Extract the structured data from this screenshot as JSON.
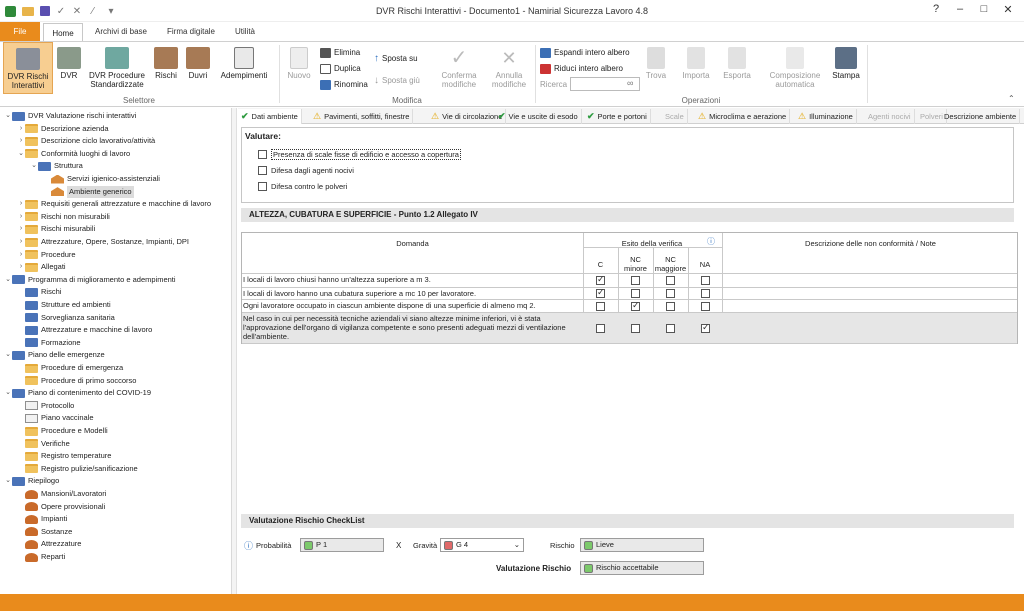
{
  "app": {
    "title": "DVR Rischi Interattivi - Documento1 - Namirial Sicurezza Lavoro 4.8",
    "help": "?",
    "minimize": "–",
    "maximize": "□",
    "close": "✕"
  },
  "tabs": {
    "file": "File",
    "home": "Home",
    "archivi": "Archivi di base",
    "firma": "Firma digitale",
    "utilita": "Utilità"
  },
  "ribbon": {
    "dvr_rischi": "DVR Rischi Interattivi",
    "dvr": "DVR",
    "dvr_proc": "DVR Procedure Standardizzate",
    "rischi": "Rischi",
    "duvri": "Duvri",
    "adempimenti": "Adempimenti",
    "group_selettore": "Selettore",
    "nuovo": "Nuovo",
    "elimina": "Elimina",
    "duplica": "Duplica",
    "rinomina": "Rinomina",
    "sposta_su": "Sposta su",
    "sposta_giu": "Sposta giù",
    "conferma": "Conferma modifiche",
    "annulla": "Annulla modifiche",
    "group_modifica": "Modifica",
    "espandi": "Espandi intero albero",
    "riduci": "Riduci intero albero",
    "ricerca": "Ricerca",
    "trova": "Trova",
    "importa": "Importa",
    "esporta": "Esporta",
    "composizione": "Composizione automatica",
    "stampa": "Stampa",
    "group_operazioni": "Operazioni"
  },
  "tree": [
    {
      "label": "DVR Valutazione rischi interattivi",
      "lvl": 0,
      "icon": "docblue",
      "tog": "⌄"
    },
    {
      "label": "Descrizione azienda",
      "lvl": 1,
      "icon": "folder",
      "tog": "›"
    },
    {
      "label": "Descrizione ciclo lavorativo/attività",
      "lvl": 1,
      "icon": "folder",
      "tog": "›"
    },
    {
      "label": "Conformità luoghi di lavoro",
      "lvl": 1,
      "icon": "folder",
      "tog": "⌄"
    },
    {
      "label": "Struttura",
      "lvl": 2,
      "icon": "building",
      "tog": "⌄"
    },
    {
      "label": "Servizi igienico-assistenziali",
      "lvl": 3,
      "icon": "house",
      "tog": ""
    },
    {
      "label": "Ambiente generico",
      "lvl": 3,
      "icon": "house",
      "tog": "",
      "sel": true
    },
    {
      "label": "Requisiti generali attrezzature e macchine di lavoro",
      "lvl": 1,
      "icon": "folder",
      "tog": "›"
    },
    {
      "label": "Rischi non misurabili",
      "lvl": 1,
      "icon": "folder",
      "tog": "›"
    },
    {
      "label": "Rischi misurabili",
      "lvl": 1,
      "icon": "folder",
      "tog": "›"
    },
    {
      "label": "Attrezzature, Opere, Sostanze, Impianti, DPI",
      "lvl": 1,
      "icon": "folder",
      "tog": "›"
    },
    {
      "label": "Procedure",
      "lvl": 1,
      "icon": "folder",
      "tog": "›"
    },
    {
      "label": "Allegati",
      "lvl": 1,
      "icon": "folder",
      "tog": "›"
    },
    {
      "label": "Programma di miglioramento e adempimenti",
      "lvl": 0,
      "icon": "docblue",
      "tog": "⌄"
    },
    {
      "label": "Rischi",
      "lvl": 1,
      "icon": "doclink",
      "tog": ""
    },
    {
      "label": "Strutture ed ambienti",
      "lvl": 1,
      "icon": "doclink",
      "tog": ""
    },
    {
      "label": "Sorveglianza sanitaria",
      "lvl": 1,
      "icon": "doclink",
      "tog": ""
    },
    {
      "label": "Attrezzature e macchine di lavoro",
      "lvl": 1,
      "icon": "doclink",
      "tog": ""
    },
    {
      "label": "Formazione",
      "lvl": 1,
      "icon": "doclink",
      "tog": ""
    },
    {
      "label": "Piano delle emergenze",
      "lvl": 0,
      "icon": "docblue",
      "tog": "⌄"
    },
    {
      "label": "Procedure di emergenza",
      "lvl": 1,
      "icon": "folder",
      "tog": ""
    },
    {
      "label": "Procedure di primo soccorso",
      "lvl": 1,
      "icon": "folder",
      "tog": ""
    },
    {
      "label": "Piano di contenimento del COVID-19",
      "lvl": 0,
      "icon": "docblue",
      "tog": "⌄"
    },
    {
      "label": "Protocollo",
      "lvl": 1,
      "icon": "doc",
      "tog": ""
    },
    {
      "label": "Piano vaccinale",
      "lvl": 1,
      "icon": "doc",
      "tog": ""
    },
    {
      "label": "Procedure e Modelli",
      "lvl": 1,
      "icon": "folder",
      "tog": ""
    },
    {
      "label": "Verifiche",
      "lvl": 1,
      "icon": "folder",
      "tog": ""
    },
    {
      "label": "Registro temperature",
      "lvl": 1,
      "icon": "folder",
      "tog": ""
    },
    {
      "label": "Registro pulizie/sanificazione",
      "lvl": 1,
      "icon": "folder",
      "tog": ""
    },
    {
      "label": "Riepilogo",
      "lvl": 0,
      "icon": "docblue",
      "tog": "⌄"
    },
    {
      "label": "Mansioni/Lavoratori",
      "lvl": 1,
      "icon": "person",
      "tog": ""
    },
    {
      "label": "Opere provvisionali",
      "lvl": 1,
      "icon": "person",
      "tog": ""
    },
    {
      "label": "Impianti",
      "lvl": 1,
      "icon": "person",
      "tog": ""
    },
    {
      "label": "Sostanze",
      "lvl": 1,
      "icon": "person",
      "tog": ""
    },
    {
      "label": "Attrezzature",
      "lvl": 1,
      "icon": "person",
      "tog": ""
    },
    {
      "label": "Reparti",
      "lvl": 1,
      "icon": "person",
      "tog": ""
    }
  ],
  "content_tabs": [
    {
      "label": "Dati ambiente",
      "icon": "check",
      "state": "active"
    },
    {
      "label": "Pavimenti, soffitti, finestre",
      "icon": "warn",
      "state": ""
    },
    {
      "label": "Vie di circolazione",
      "icon": "warn",
      "state": ""
    },
    {
      "label": "Vie e uscite di esodo",
      "icon": "check",
      "state": ""
    },
    {
      "label": "Porte e portoni",
      "icon": "check",
      "state": ""
    },
    {
      "label": "Scale",
      "icon": "",
      "state": "dis"
    },
    {
      "label": "Microclima e aerazione",
      "icon": "warn",
      "state": ""
    },
    {
      "label": "Illuminazione",
      "icon": "warn",
      "state": ""
    },
    {
      "label": "Agenti nocivi",
      "icon": "",
      "state": "dis"
    },
    {
      "label": "Polveri",
      "icon": "",
      "state": "dis"
    },
    {
      "label": "Descrizione ambiente",
      "icon": "",
      "state": ""
    }
  ],
  "valutare": {
    "title": "Valutare:",
    "items": [
      {
        "label": "Presenza di scale fisse di edificio e accesso a copertura",
        "checked": false
      },
      {
        "label": "Difesa dagli agenti nocivi",
        "checked": false
      },
      {
        "label": "Difesa contro le polveri",
        "checked": false
      }
    ]
  },
  "section_title": "ALTEZZA, CUBATURA E SUPERFICIE - Punto 1.2 Allegato IV",
  "table": {
    "col_domanda": "Domanda",
    "col_esito": "Esito della verifica",
    "col_desc": "Descrizione delle non conformità / Note",
    "col_c": "C",
    "col_ncmin": "NC minore",
    "col_ncmag": "NC maggiore",
    "col_na": "NA",
    "rows": [
      {
        "q": "I locali di lavoro chiusi hanno un'altezza superiore a m 3.",
        "c": true,
        "ncmin": false,
        "ncmag": false,
        "na": false
      },
      {
        "q": "I locali di lavoro hanno una cubatura superiore a mc 10 per lavoratore.",
        "c": true,
        "ncmin": false,
        "ncmag": false,
        "na": false
      },
      {
        "q": "Ogni lavoratore occupato in ciascun ambiente dispone di una superficie di almeno mq 2.",
        "c": false,
        "ncmin": true,
        "ncmag": false,
        "na": false
      },
      {
        "q": "Nel caso in cui per necessità tecniche aziendali vi siano altezze minime inferiori, vi è stata l'approvazione dell'organo di vigilanza competente e sono presenti adeguati mezzi di ventilazione dell'ambiente.",
        "c": false,
        "ncmin": false,
        "ncmag": false,
        "na": true
      }
    ]
  },
  "valutazione": {
    "title": "Valutazione Rischio CheckList",
    "prob_label": "Probabilità",
    "prob_value": "P 1",
    "x": "X",
    "grav_label": "Gravità",
    "grav_value": "G 4",
    "rischio_label": "Rischio",
    "rischio_value": "Lieve",
    "valut_label": "Valutazione Rischio",
    "valut_value": "Rischio accettabile"
  },
  "colors": {
    "accent": "#e98b1c",
    "green": "#7cc96b",
    "red": "#e06a6a"
  }
}
